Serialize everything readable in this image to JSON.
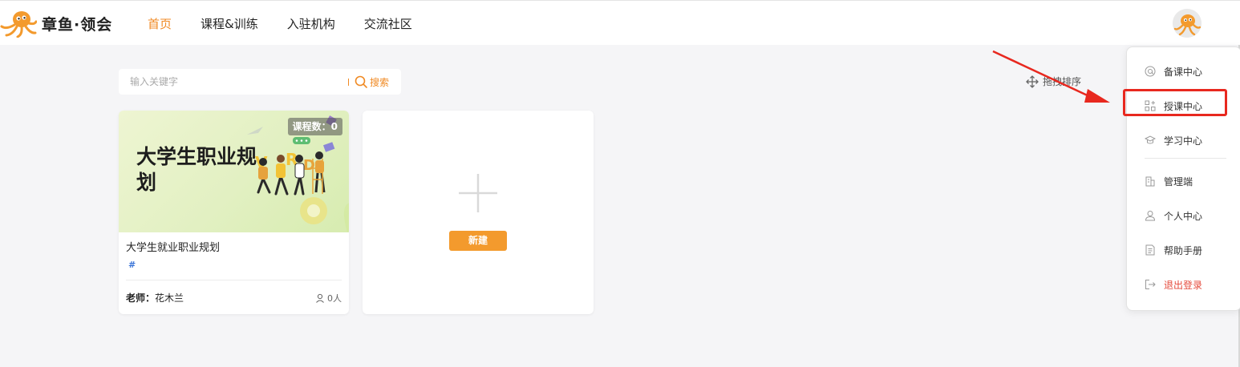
{
  "header": {
    "logo_text": "章鱼·领会",
    "nav": [
      {
        "label": "首页",
        "active": true
      },
      {
        "label": "课程&训练",
        "active": false
      },
      {
        "label": "入驻机构",
        "active": false
      },
      {
        "label": "交流社区",
        "active": false
      }
    ]
  },
  "search": {
    "placeholder": "输入关键字",
    "button_label": "搜索"
  },
  "toolbar": {
    "drag_sort_label": "拖拽排序"
  },
  "course_card": {
    "banner_title": "大学生职业规划",
    "badge": "课程数：0",
    "name": "大学生就业职业规划",
    "tag": "#",
    "teacher_label": "老师：",
    "teacher_name": "花木兰",
    "students": "0人"
  },
  "new_card": {
    "button_label": "新建"
  },
  "dropdown": {
    "items": [
      {
        "label": "备课中心",
        "icon": "at-icon"
      },
      {
        "label": "授课中心",
        "icon": "grid-plus-icon",
        "highlighted": true
      },
      {
        "label": "学习中心",
        "icon": "graduation-cap-icon"
      },
      {
        "label": "管理端",
        "icon": "building-icon"
      },
      {
        "label": "个人中心",
        "icon": "user-icon"
      },
      {
        "label": "帮助手册",
        "icon": "document-icon"
      },
      {
        "label": "退出登录",
        "icon": "logout-icon"
      }
    ]
  },
  "colors": {
    "accent": "#f08a24",
    "annotation_red": "#e8281f",
    "logout_red": "#e54a3b",
    "tag_blue": "#3a74d8"
  }
}
